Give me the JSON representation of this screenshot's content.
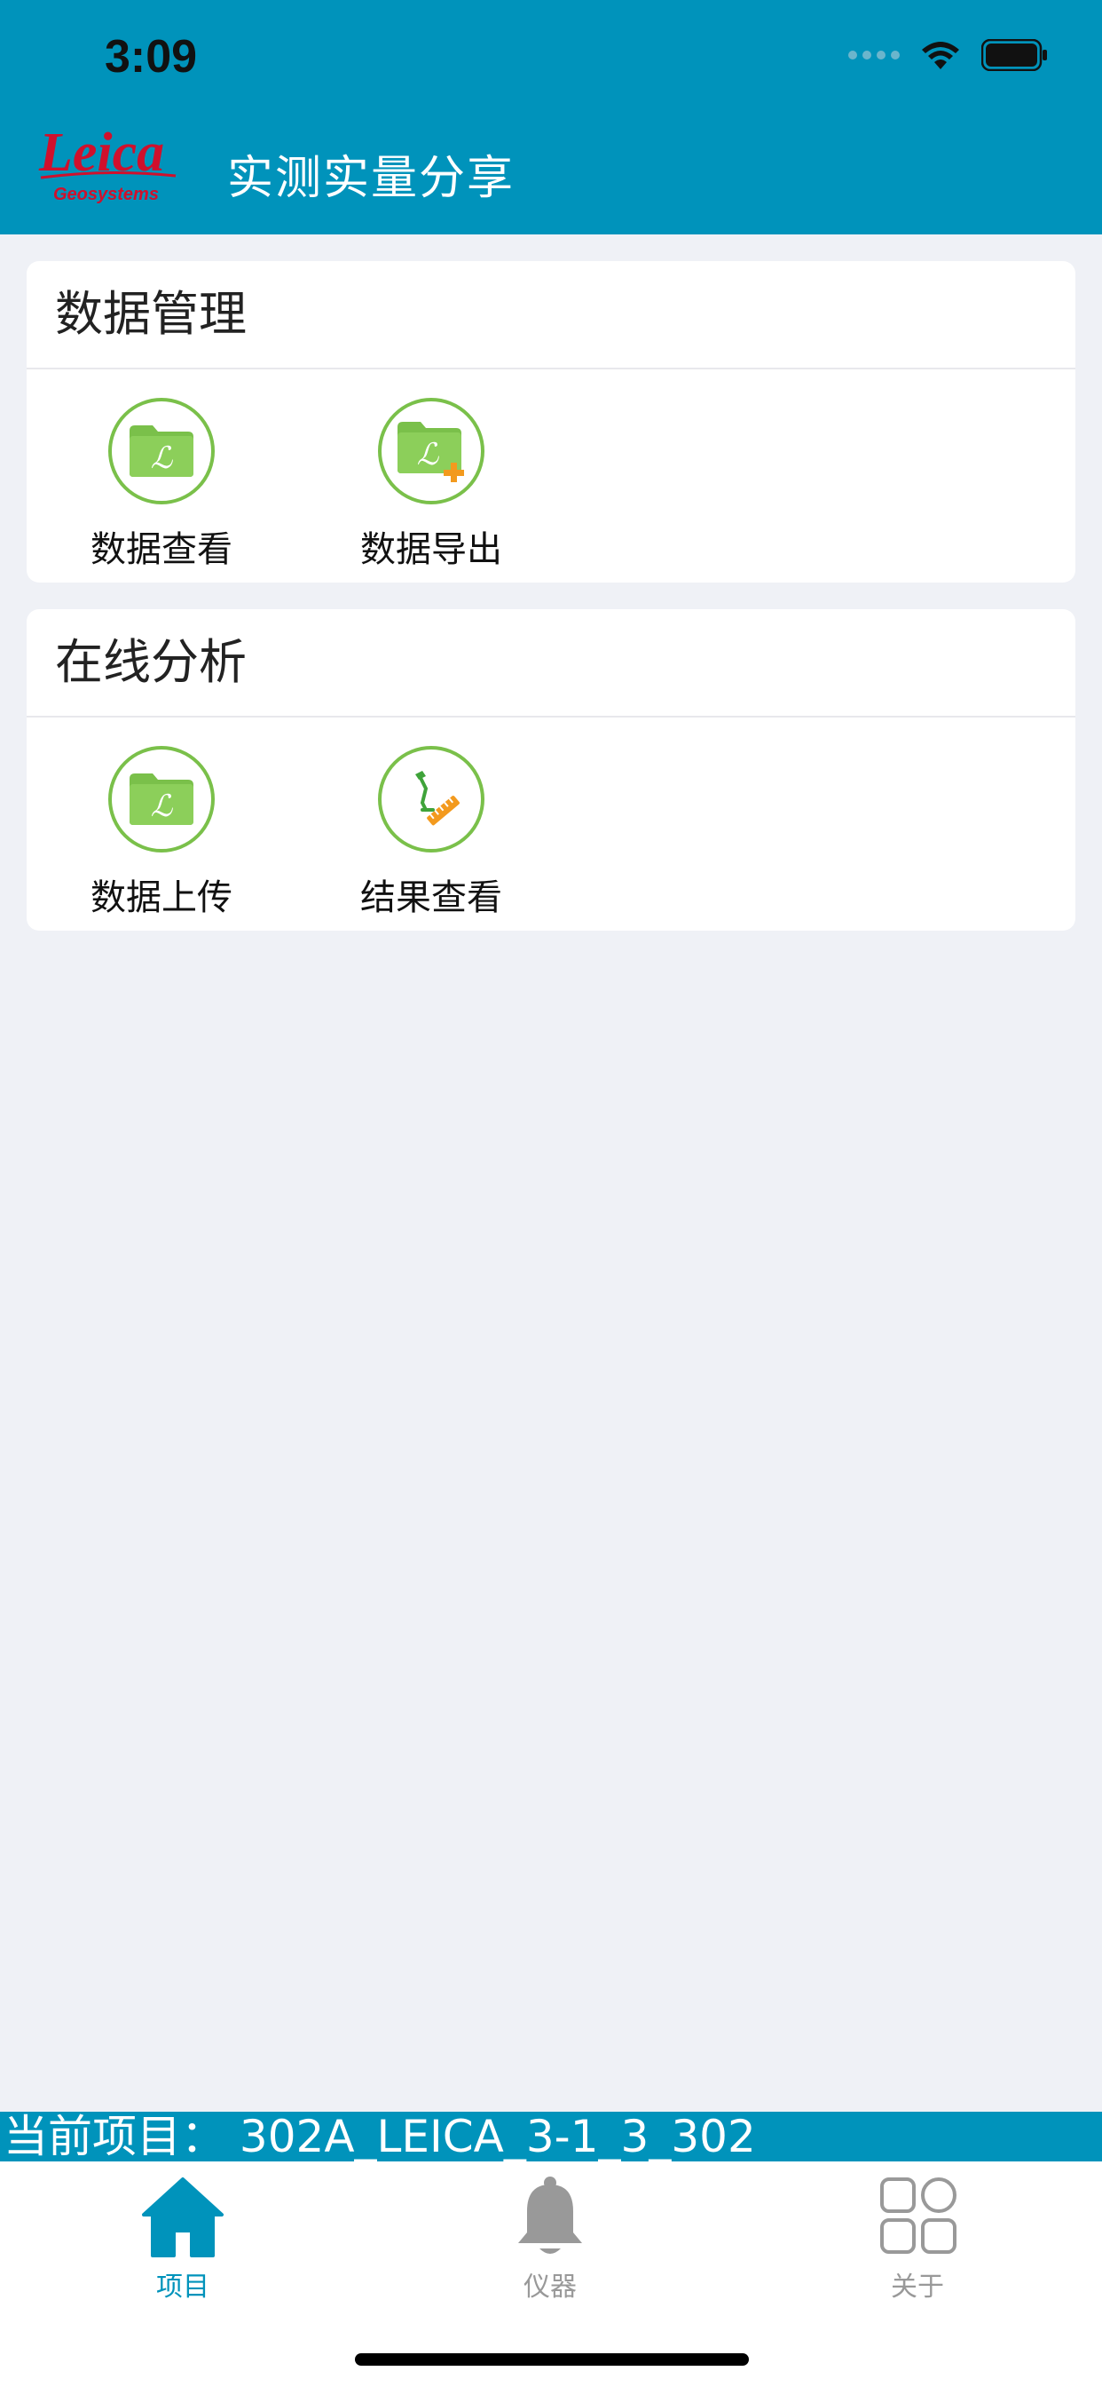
{
  "status": {
    "time": "3:09"
  },
  "header": {
    "logo_text": "Leica",
    "logo_sub": "Geosystems",
    "title": "实测实量分享"
  },
  "sections": [
    {
      "title": "数据管理",
      "items": [
        {
          "label": "数据查看",
          "icon": "folder-icon"
        },
        {
          "label": "数据导出",
          "icon": "folder-add-icon"
        }
      ]
    },
    {
      "title": "在线分析",
      "items": [
        {
          "label": "数据上传",
          "icon": "folder-icon"
        },
        {
          "label": "结果查看",
          "icon": "measure-icon"
        }
      ]
    }
  ],
  "current_project": "当前项目：  302A_LEICA_3-1_3_302",
  "tabs": [
    {
      "label": "项目",
      "icon": "home-icon",
      "active": true
    },
    {
      "label": "仪器",
      "icon": "bell-icon",
      "active": false
    },
    {
      "label": "关于",
      "icon": "grid-icon",
      "active": false
    }
  ],
  "colors": {
    "brand": "#0093bb",
    "accent_green": "#7ac04a",
    "inactive": "#999999"
  }
}
